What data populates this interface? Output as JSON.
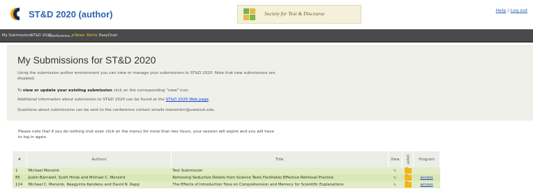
{
  "header": {
    "conf_title": "ST&D 2020 (author)",
    "society_text": "Society for Text & Discourse",
    "help_link": "Help",
    "separator": "/",
    "logout_link": "Log out"
  },
  "menu": {
    "items": [
      {
        "label": "My Submissions",
        "color": "#e8e8e8"
      },
      {
        "label": "ST&D 2020",
        "color": "#e8e8e8"
      },
      {
        "label": "Conference",
        "color": "#e8e8e8"
      },
      {
        "label": "News",
        "color": "#f2d51c"
      },
      {
        "label": "Alerts",
        "color": "#f2d51c"
      },
      {
        "label": "EasyChair",
        "color": "#e8e8e8"
      }
    ]
  },
  "main": {
    "title": "My Submissions for ST&D 2020",
    "para1_line1": "Using the submission author environment you can view or manage your submissions to ST&D 2020. Note that new submissions are",
    "para1_line2": "disabled.",
    "para2_pre": "To ",
    "para2_bold": "view or update your existing submission",
    "para2_post": " click on the corresponding \"view\" icon.",
    "para3_pre": "Additional information about submission to ST&D 2020 can be found at the ",
    "para3_link": "ST&D 2020 Web page",
    "para3_post": ".",
    "para4": "Questions about submissions can be sent to the conference contact emails mensinkm@uwstout.edu."
  },
  "note": {
    "line1": "Please note that if you do nothing (not even click on the menu) for more than two hours, your session will expire and you will have",
    "line2": "to log in again."
  },
  "table": {
    "headers": {
      "num": "#",
      "authors": "Authors",
      "title": "Title",
      "view": "View",
      "paper": "paper",
      "program": "Program"
    },
    "rows": [
      {
        "num": "1",
        "authors": "Michael Mensink",
        "title": "Test Submission",
        "program": ""
      },
      {
        "num": "85",
        "authors": "Justin Barnwell, Scott Hinze and Michael C. Mensink",
        "title": "Removing Seductive Details from Science Texts Facilitates Effective Retrieval Practice",
        "program": "access"
      },
      {
        "num": "124",
        "authors": "Michael C. Mensink, Reagyinta Kendeou and David N. Rapp",
        "title": "The Effects of Introduction Tone on Comprehension and Memory for Scientific Explanations",
        "program": "access"
      }
    ]
  }
}
